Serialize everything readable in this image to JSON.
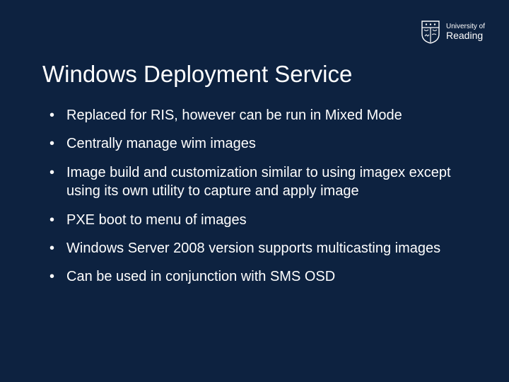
{
  "logo": {
    "line1": "University of",
    "line2": "Reading"
  },
  "title": "Windows Deployment Service",
  "bullets": [
    "Replaced for RIS, however can be run in Mixed Mode",
    "Centrally manage wim images",
    "Image build and customization similar to using imagex except using its own utility to capture and apply image",
    "PXE boot to menu of images",
    "Windows Server 2008 version supports multicasting images",
    "Can be used in conjunction with SMS OSD"
  ]
}
